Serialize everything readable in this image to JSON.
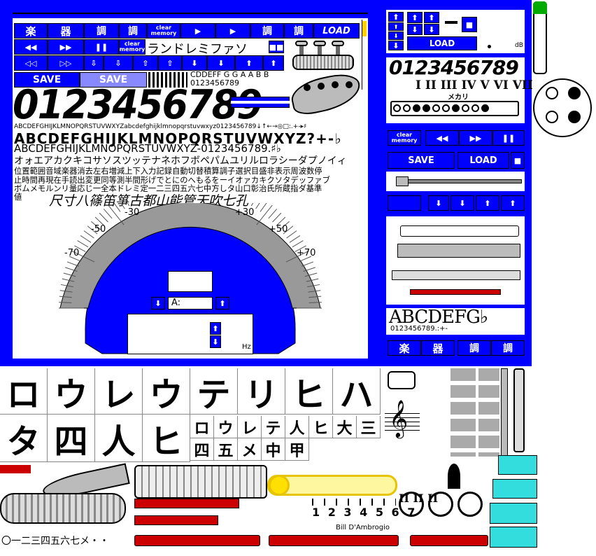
{
  "left_panel": {
    "row1": [
      "楽",
      "器",
      "調",
      "調",
      "clear memory",
      "▶",
      "▶",
      "調",
      "調",
      "LOAD"
    ],
    "row2": [
      "◀◀",
      "▶▶",
      "❚❚",
      "clear memory"
    ],
    "row3": [
      "◁◁",
      "▷▷",
      "⇩",
      "⇩",
      "⇧",
      "⇧",
      "⬇",
      "⬇",
      "⬆",
      "⬆"
    ],
    "save_labels": [
      "SAVE",
      "SAVE"
    ],
    "katakana_scale": "ランドレミファソ",
    "small_alpha": "CDDEFF G G A A B B",
    "small_digits": "0123456789",
    "big_digits": "0123456789",
    "alphabet_small": "ABCDEFGHIJKLMNOPQRSTUVWXYZabcdefghijklmnopqrstuvwxyz0123456789↓↑←→◎□:.+-▸♯",
    "alphabet_bold": "ABCDEFGHIJKLMNOPQRSTUVWXYZ?+-♭",
    "alphabet_medium": "ABCDEFGHIJKLMNOPQRSTUVWXYZ-0123456789.♯♭",
    "katakana_line": "オォエアカクキコサソスツッテナネホフボペパムユリルロラシーダプノイィ",
    "kanji_lines": [
      "位置範囲音域楽器消去左右増減上下入力記録自動切替積算調子選択目盛非表示周波数停",
      "止時間再現在手読出変更同等測半間形げでとにのへもるをーイオァカキクソタデッファブ",
      "ボムメモルンリ量応じ一全本ドレミ定一二三四五六七中方しタ山口彰治氏所蔵指ダ基準",
      "値"
    ],
    "brush_line": "尺寸八篠笛箏古都山能管天吹七孔",
    "gauge_labels": [
      "-30",
      "+30",
      "-50",
      "+50",
      "-70",
      "+70"
    ],
    "note_display": "A:",
    "freq_unit": "Hz"
  },
  "right_panel": {
    "db_unit": "dB",
    "load_label": "LOAD",
    "digits": "0123456789",
    "roman_numerals": "I II III IV V VI VII",
    "meri_label": "メカリ",
    "clear_memory": "clear memory",
    "transport": [
      "◀◀",
      "▶▶",
      "❚❚"
    ],
    "save_label": "SAVE",
    "load2_label": "LOAD",
    "arrows": [
      "⬇",
      "⬇",
      "⬆",
      "⬆"
    ],
    "serif_alpha": "ABCDEFG♭",
    "serif_digits": "0123456789.:+-",
    "bottom_buttons": [
      "楽",
      "器",
      "調",
      "調"
    ]
  },
  "lower_area": {
    "kana_row1": [
      "ロ",
      "ウ",
      "レ",
      "ウ",
      "テ",
      "リ",
      "ヒ",
      "ハ"
    ],
    "kana_row2": [
      "タ",
      "四",
      "人",
      "ヒ"
    ],
    "kana_small": [
      "ロ",
      "ウ",
      "レ",
      "テ",
      "人",
      "ヒ",
      "大",
      "三",
      "四",
      "五",
      "メ",
      "中",
      "甲"
    ],
    "kanji_numbers": "〇一二三四五六七メ・・",
    "credit": "Bill D'Ambrogio",
    "trombone_positions": "1 2 3 4 5 6 7",
    "roman_small": "II II II"
  }
}
